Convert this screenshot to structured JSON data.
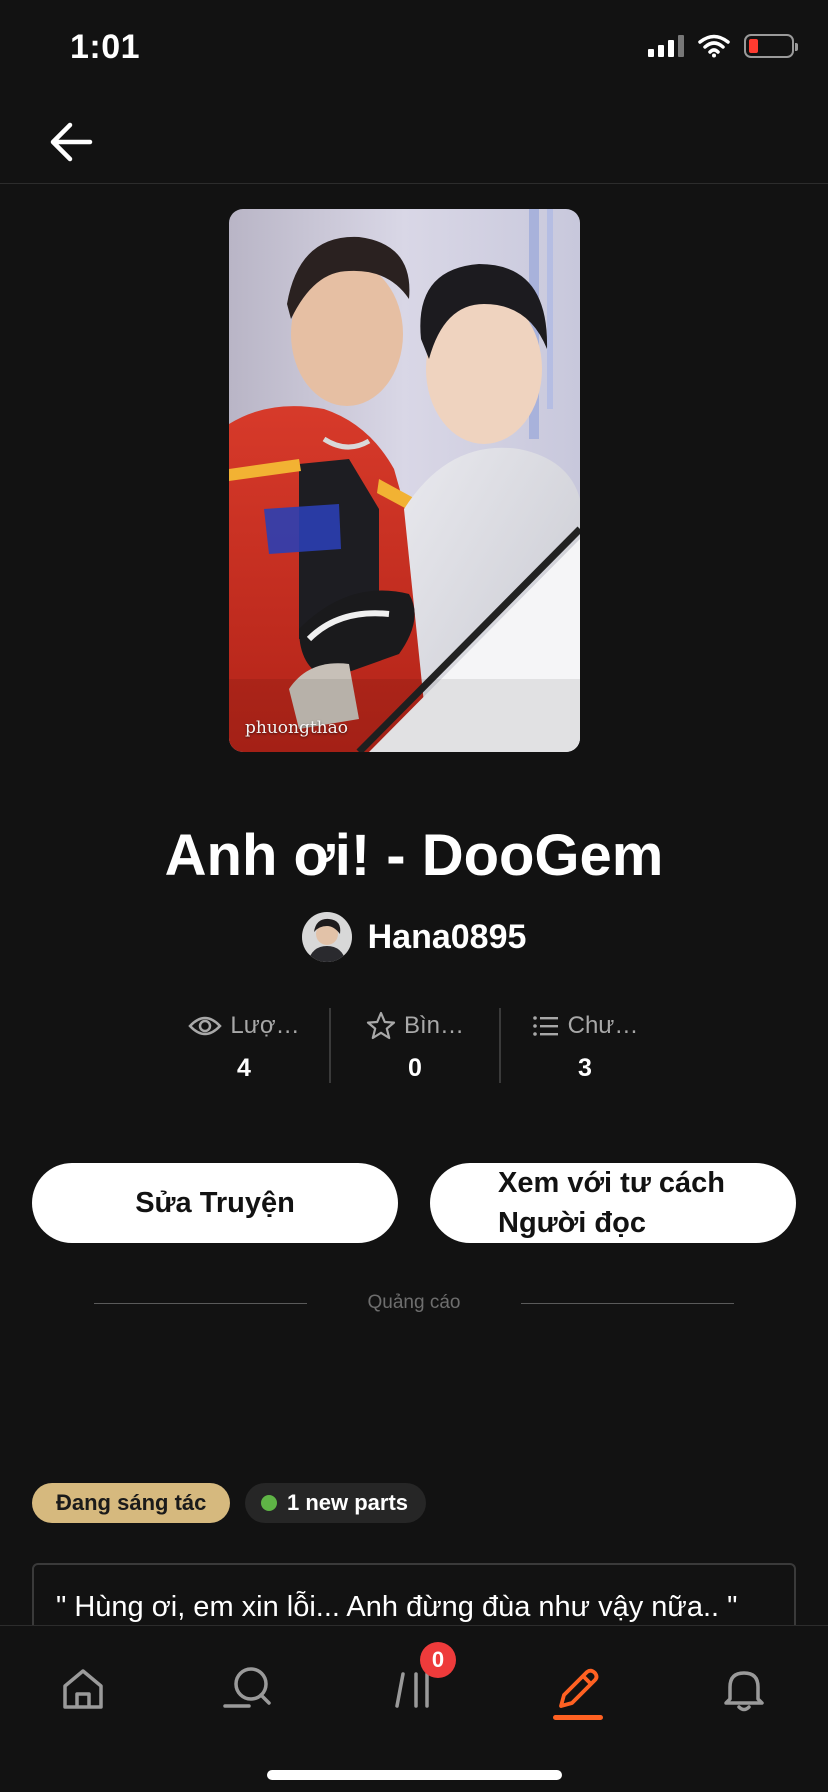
{
  "status_bar": {
    "time": "1:01"
  },
  "story": {
    "title": "Anh ơi! - DooGem",
    "cover_credit": "phuongthao",
    "author": "Hana0895"
  },
  "stats": [
    {
      "label": "Lượ…",
      "value": "4",
      "icon": "eye-icon"
    },
    {
      "label": "Bìn…",
      "value": "0",
      "icon": "star-icon"
    },
    {
      "label": "Chư…",
      "value": "3",
      "icon": "list-icon"
    }
  ],
  "actions": {
    "edit_label": "Sửa Truyện",
    "reader_label_line1": "Xem với tư cách",
    "reader_label_line2": "Người đọc"
  },
  "ad": {
    "label": "Quảng cáo"
  },
  "tags": {
    "status": "Đang sáng tác",
    "new_parts": "1 new parts"
  },
  "description": "\" Hùng ơi, em xin lỗi... Anh đừng đùa như vậy nữa.. \"",
  "tab_bar": {
    "library_badge": "0",
    "active_tab": "write",
    "active_color": "#ff6122"
  }
}
